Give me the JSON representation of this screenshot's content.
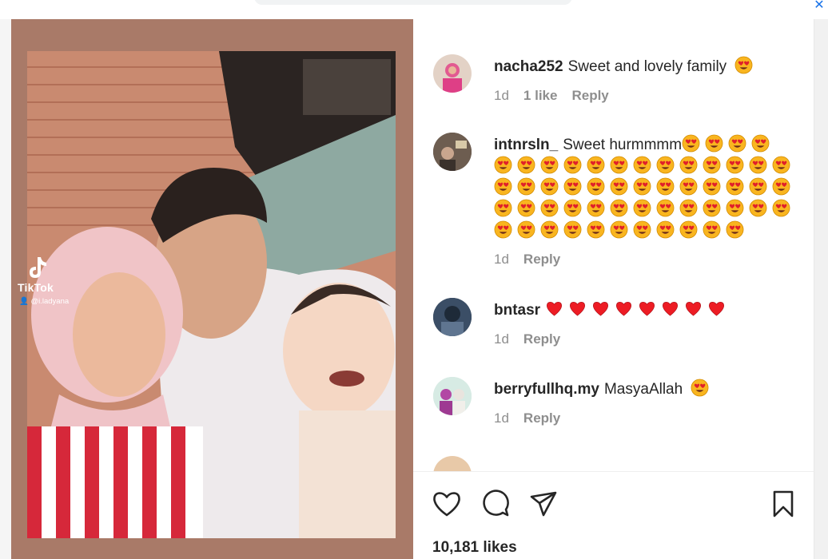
{
  "watermark": {
    "brand": "TikTok",
    "handle": "@i.ladyana"
  },
  "comments": [
    {
      "username": "nacha252",
      "text": "Sweet and lovely family",
      "emoji_count": 1,
      "time": "1d",
      "likes": "1 like",
      "reply": "Reply"
    },
    {
      "username": "intnrsln_",
      "text": "Sweet hurmmmm",
      "emoji_count": 4,
      "extra_emoji_rows": [
        13,
        13,
        13,
        11
      ],
      "time": "1d",
      "reply": "Reply"
    },
    {
      "username": "bntasr",
      "text": "",
      "heart_count": 8,
      "time": "1d",
      "reply": "Reply"
    },
    {
      "username": "berryfullhq.my",
      "text": "MasyaAllah",
      "emoji_count": 1,
      "time": "1d",
      "reply": "Reply"
    },
    {
      "username": "",
      "text": ""
    }
  ],
  "actions": {
    "like": "heart-icon",
    "comment": "comment-icon",
    "share": "share-icon",
    "save": "bookmark-icon"
  },
  "likes_count": "10,181 likes",
  "colors": {
    "media_bg": "#a97a68",
    "meta": "#8e8e8e",
    "heart": "#ed1c24",
    "emoji_face": "#f9b51f"
  }
}
